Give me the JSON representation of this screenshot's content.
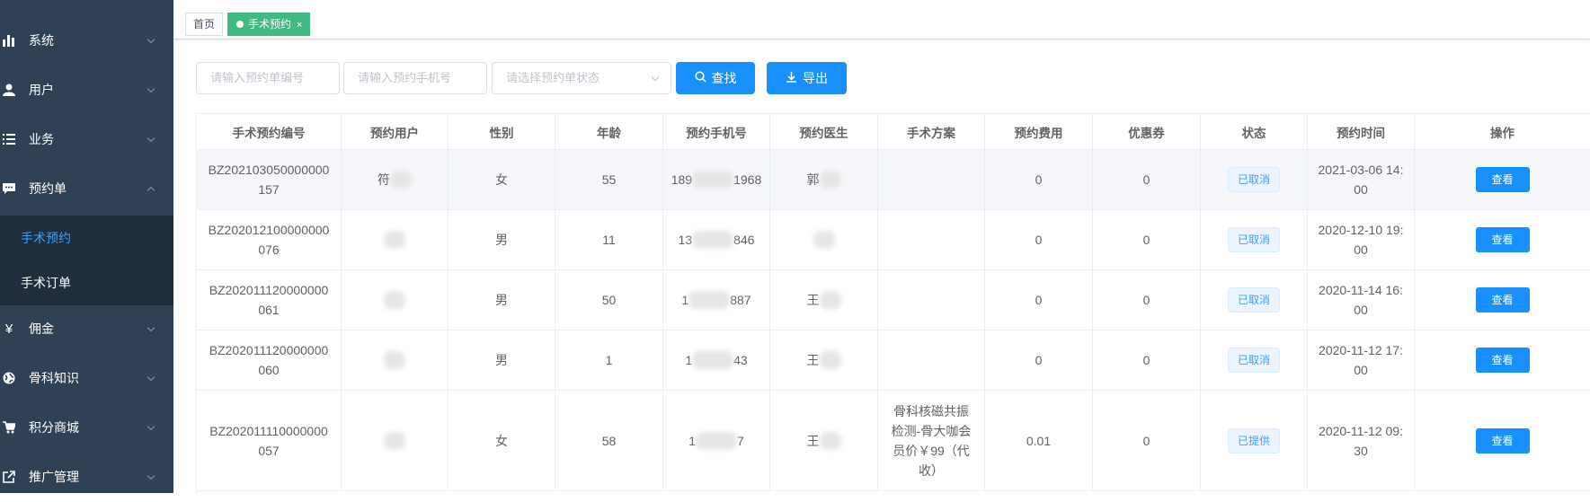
{
  "sidebar": {
    "items": [
      {
        "label": "系统",
        "icon": "bar-chart-icon"
      },
      {
        "label": "用户",
        "icon": "user-icon"
      },
      {
        "label": "业务",
        "icon": "list-icon"
      },
      {
        "label": "预约单",
        "icon": "message-icon"
      },
      {
        "label": "佣金",
        "icon": "yen-icon"
      },
      {
        "label": "骨科知识",
        "icon": "globe-icon"
      },
      {
        "label": "积分商城",
        "icon": "cart-icon"
      },
      {
        "label": "推广管理",
        "icon": "external-link-icon"
      }
    ],
    "submenu": [
      {
        "label": "手术预约"
      },
      {
        "label": "手术订单"
      }
    ]
  },
  "tags": {
    "home": "首页",
    "current": "手术预约",
    "close": "×"
  },
  "filters": {
    "order_no_placeholder": "请输入预约单编号",
    "phone_placeholder": "请输入预约手机号",
    "status_placeholder": "请选择预约单状态",
    "search_label": "查找",
    "export_label": "导出"
  },
  "table": {
    "columns": [
      "手术预约编号",
      "预约用户",
      "性别",
      "年龄",
      "预约手机号",
      "预约医生",
      "手术方案",
      "预约费用",
      "优惠券",
      "状态",
      "预约时间",
      "操作"
    ],
    "rows": [
      {
        "no_1": "BZ202103050000000",
        "no_2": "157",
        "user": "符",
        "gender": "女",
        "age": "55",
        "phone_pre": "189",
        "phone_suf": "1968",
        "doctor": "郭",
        "plan": "",
        "fee": "0",
        "coupon": "0",
        "status": "已取消",
        "time_1": "2021-03-06 14:",
        "time_2": "00",
        "action": "查看"
      },
      {
        "no_1": "BZ202012100000000",
        "no_2": "076",
        "user": "",
        "gender": "男",
        "age": "11",
        "phone_pre": "13",
        "phone_suf": "846",
        "doctor": "",
        "plan": "",
        "fee": "0",
        "coupon": "0",
        "status": "已取消",
        "time_1": "2020-12-10 19:",
        "time_2": "00",
        "action": "查看"
      },
      {
        "no_1": "BZ202011120000000",
        "no_2": "061",
        "user": "",
        "gender": "男",
        "age": "50",
        "phone_pre": "1",
        "phone_suf": "887",
        "doctor": "王",
        "plan": "",
        "fee": "0",
        "coupon": "0",
        "status": "已取消",
        "time_1": "2020-11-14 16:",
        "time_2": "00",
        "action": "查看"
      },
      {
        "no_1": "BZ202011120000000",
        "no_2": "060",
        "user": "",
        "gender": "男",
        "age": "1",
        "phone_pre": "1",
        "phone_suf": "43",
        "doctor": "王",
        "plan": "",
        "fee": "0",
        "coupon": "0",
        "status": "已取消",
        "time_1": "2020-11-12 17:",
        "time_2": "00",
        "action": "查看"
      },
      {
        "no_1": "BZ202011110000000",
        "no_2": "057",
        "user": "",
        "gender": "女",
        "age": "58",
        "phone_pre": "1",
        "phone_suf": "7",
        "doctor": "王",
        "plan": "骨科核磁共振检测-骨大咖会员价￥99（代收）",
        "fee": "0.01",
        "coupon": "0",
        "status": "已提供",
        "time_1": "2020-11-12 09:",
        "time_2": "30",
        "action": "查看"
      }
    ]
  }
}
